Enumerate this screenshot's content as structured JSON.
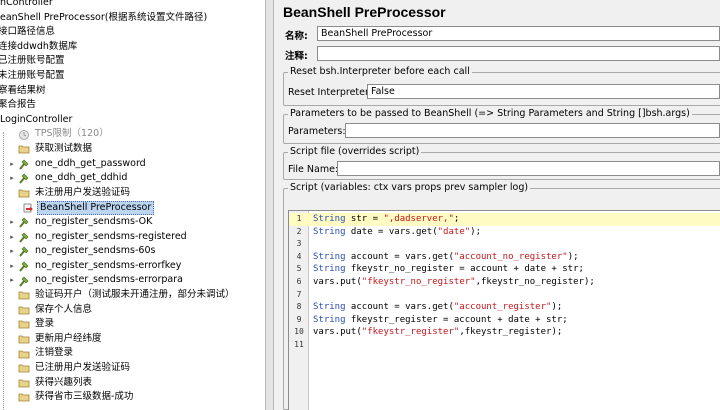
{
  "tree": {
    "items": [
      {
        "label": "nController",
        "x": -2,
        "icon": "none"
      },
      {
        "label": "eanShell PreProcessor(根据系统设置文件路径)",
        "x": -2,
        "icon": "none"
      },
      {
        "label": "接口路径信息",
        "x": -4,
        "icon": "none"
      },
      {
        "label": "连接ddwdh数据库",
        "x": -4,
        "icon": "none"
      },
      {
        "label": "已注册账号配置",
        "x": -4,
        "icon": "none"
      },
      {
        "label": "未注册账号配置",
        "x": -4,
        "icon": "none"
      },
      {
        "label": "察看结果树",
        "x": -4,
        "icon": "none"
      },
      {
        "label": "聚合报告",
        "x": -4,
        "icon": "none"
      },
      {
        "label": "LoginController",
        "x": -2,
        "icon": "none"
      },
      {
        "label": "TPS限制（120）",
        "x": 8,
        "icon": "timer-icon",
        "disabled": true
      },
      {
        "label": "获取测试数据",
        "x": 8,
        "icon": "folder-icon"
      },
      {
        "label": "one_ddh_get_password",
        "x": 8,
        "icon": "sampler-icon",
        "expander": true
      },
      {
        "label": "one_ddh_get_ddhid",
        "x": 8,
        "icon": "sampler-icon",
        "expander": true
      },
      {
        "label": "未注册用户发送验证码",
        "x": 8,
        "icon": "folder-icon"
      },
      {
        "label": "BeanShell PreProcessor",
        "x": 12,
        "icon": "preprocessor-icon",
        "selected": true
      },
      {
        "label": "no_register_sendsms-OK",
        "x": 8,
        "icon": "sampler-icon",
        "expander": true
      },
      {
        "label": "no_register_sendsms-registered",
        "x": 8,
        "icon": "sampler-icon",
        "expander": true
      },
      {
        "label": "no_register_sendsms-60s",
        "x": 8,
        "icon": "sampler-icon",
        "expander": true
      },
      {
        "label": "no_register_sendsms-errorfkey",
        "x": 8,
        "icon": "sampler-icon",
        "expander": true
      },
      {
        "label": "no_register_sendsms-errorpara",
        "x": 8,
        "icon": "sampler-icon",
        "expander": true
      },
      {
        "label": "验证码开户（测试服未开通注册，部分未调试）",
        "x": 8,
        "icon": "folder-icon"
      },
      {
        "label": "保存个人信息",
        "x": 8,
        "icon": "folder-icon"
      },
      {
        "label": "登录",
        "x": 8,
        "icon": "folder-icon"
      },
      {
        "label": "更新用户经纬度",
        "x": 8,
        "icon": "folder-icon"
      },
      {
        "label": "注销登录",
        "x": 8,
        "icon": "folder-icon"
      },
      {
        "label": "已注册用户发送验证码",
        "x": 8,
        "icon": "folder-icon"
      },
      {
        "label": "获得兴趣列表",
        "x": 8,
        "icon": "folder-icon"
      },
      {
        "label": "获得省市三级数据-成功",
        "x": 8,
        "icon": "folder-icon"
      }
    ]
  },
  "panel": {
    "title": "BeanShell PreProcessor",
    "name_label": "名称:",
    "name_value": "BeanShell PreProcessor",
    "comment_label": "注释:",
    "comment_value": "",
    "reset_section": "Reset bsh.Interpreter before each call",
    "reset_label": "Reset Interpreter:",
    "reset_value": "False",
    "params_section": "Parameters to be passed to BeanShell (=> String Parameters and String []bsh.args)",
    "params_label": "Parameters:",
    "params_value": "",
    "file_section": "Script file (overrides script)",
    "file_label": "File Name:",
    "file_value": "",
    "script_section": "Script (variables: ctx vars props prev sampler log)"
  },
  "script": {
    "lines": [
      {
        "n": "1",
        "tokens": [
          [
            "kw",
            "String"
          ],
          [
            "t",
            " str = "
          ],
          [
            "str",
            "\",dadserver,\""
          ],
          [
            "t",
            ";"
          ]
        ]
      },
      {
        "n": "2",
        "tokens": [
          [
            "kw",
            "String"
          ],
          [
            "t",
            " date = vars.get("
          ],
          [
            "str",
            "\"date\""
          ],
          [
            "t",
            ");"
          ]
        ]
      },
      {
        "n": "3",
        "tokens": []
      },
      {
        "n": "4",
        "tokens": [
          [
            "kw",
            "String"
          ],
          [
            "t",
            " account = vars.get("
          ],
          [
            "str",
            "\"account_no_register\""
          ],
          [
            "t",
            ");"
          ]
        ]
      },
      {
        "n": "5",
        "tokens": [
          [
            "kw",
            "String"
          ],
          [
            "t",
            " fkeystr_no_register = account + date + str;"
          ]
        ]
      },
      {
        "n": "6",
        "tokens": [
          [
            "t",
            "vars.put("
          ],
          [
            "str",
            "\"fkeystr_no_register\""
          ],
          [
            "t",
            ",fkeystr_no_register);"
          ]
        ]
      },
      {
        "n": "7",
        "tokens": []
      },
      {
        "n": "8",
        "tokens": [
          [
            "kw",
            "String"
          ],
          [
            "t",
            " account = vars.get("
          ],
          [
            "str",
            "\"account_register\""
          ],
          [
            "t",
            ");"
          ]
        ]
      },
      {
        "n": "9",
        "tokens": [
          [
            "kw",
            "String"
          ],
          [
            "t",
            " fkeystr_register = account + date + str;"
          ]
        ]
      },
      {
        "n": "10",
        "tokens": [
          [
            "t",
            "vars.put("
          ],
          [
            "str",
            "\"fkeystr_register\""
          ],
          [
            "t",
            ",fkeystr_register);"
          ]
        ]
      },
      {
        "n": "11",
        "tokens": []
      }
    ]
  },
  "colors": {
    "selection": "#bcd5f0",
    "keyword": "#2a4db8",
    "string": "#c4161c",
    "current_line": "#fffbc2"
  }
}
